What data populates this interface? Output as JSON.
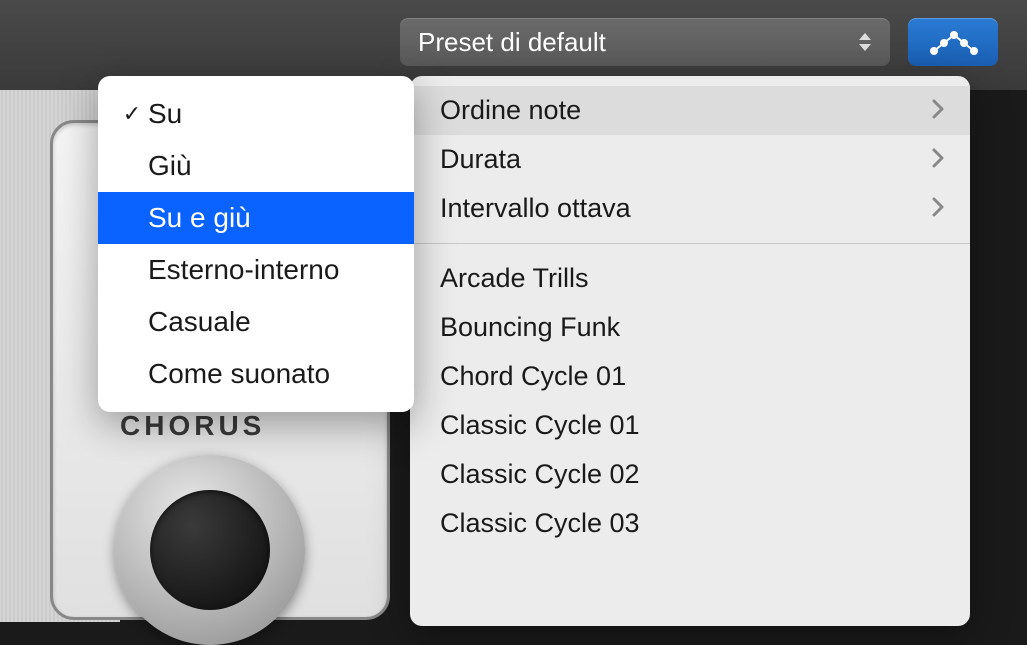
{
  "toolbar": {
    "preset_label": "Preset di default"
  },
  "panel": {
    "knob_label": "CHORUS"
  },
  "menu": {
    "items": [
      {
        "label": "Ordine note",
        "has_submenu": true,
        "hover": true
      },
      {
        "label": "Durata",
        "has_submenu": true,
        "hover": false
      },
      {
        "label": "Intervallo ottava",
        "has_submenu": true,
        "hover": false
      }
    ],
    "presets": [
      {
        "label": "Arcade Trills"
      },
      {
        "label": "Bouncing Funk"
      },
      {
        "label": "Chord Cycle 01"
      },
      {
        "label": "Classic Cycle 01"
      },
      {
        "label": "Classic Cycle 02"
      },
      {
        "label": "Classic Cycle 03"
      }
    ]
  },
  "submenu": {
    "items": [
      {
        "label": "Su",
        "checked": true,
        "selected": false
      },
      {
        "label": "Giù",
        "checked": false,
        "selected": false
      },
      {
        "label": "Su e giù",
        "checked": false,
        "selected": true
      },
      {
        "label": "Esterno-interno",
        "checked": false,
        "selected": false
      },
      {
        "label": "Casuale",
        "checked": false,
        "selected": false
      },
      {
        "label": "Come suonato",
        "checked": false,
        "selected": false
      }
    ]
  }
}
